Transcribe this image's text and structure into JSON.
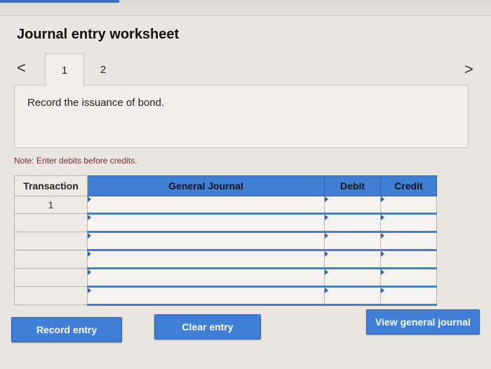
{
  "page": {
    "title": "Journal entry worksheet"
  },
  "nav": {
    "prev_icon": "chevron-left-icon",
    "next_icon": "chevron-right-icon",
    "prev_glyph": "<",
    "next_glyph": ">",
    "tabs": [
      {
        "label": "1",
        "active": true
      },
      {
        "label": "2",
        "active": false
      }
    ]
  },
  "instruction": {
    "text": "Record the issuance of bond."
  },
  "note": {
    "text": "Note: Enter debits before credits."
  },
  "table": {
    "headers": {
      "transaction": "Transaction",
      "general_journal": "General Journal",
      "debit": "Debit",
      "credit": "Credit"
    },
    "rows": [
      {
        "transaction": "1",
        "account": "",
        "debit": "",
        "credit": ""
      },
      {
        "transaction": "",
        "account": "",
        "debit": "",
        "credit": ""
      },
      {
        "transaction": "",
        "account": "",
        "debit": "",
        "credit": ""
      },
      {
        "transaction": "",
        "account": "",
        "debit": "",
        "credit": ""
      },
      {
        "transaction": "",
        "account": "",
        "debit": "",
        "credit": ""
      },
      {
        "transaction": "",
        "account": "",
        "debit": "",
        "credit": ""
      }
    ]
  },
  "buttons": {
    "record": "Record entry",
    "clear": "Clear entry",
    "view": "View general journal"
  },
  "colors": {
    "accent": "#3f7fd6",
    "note_text": "#7a2a2a",
    "panel_bg": "#f1efe9"
  }
}
